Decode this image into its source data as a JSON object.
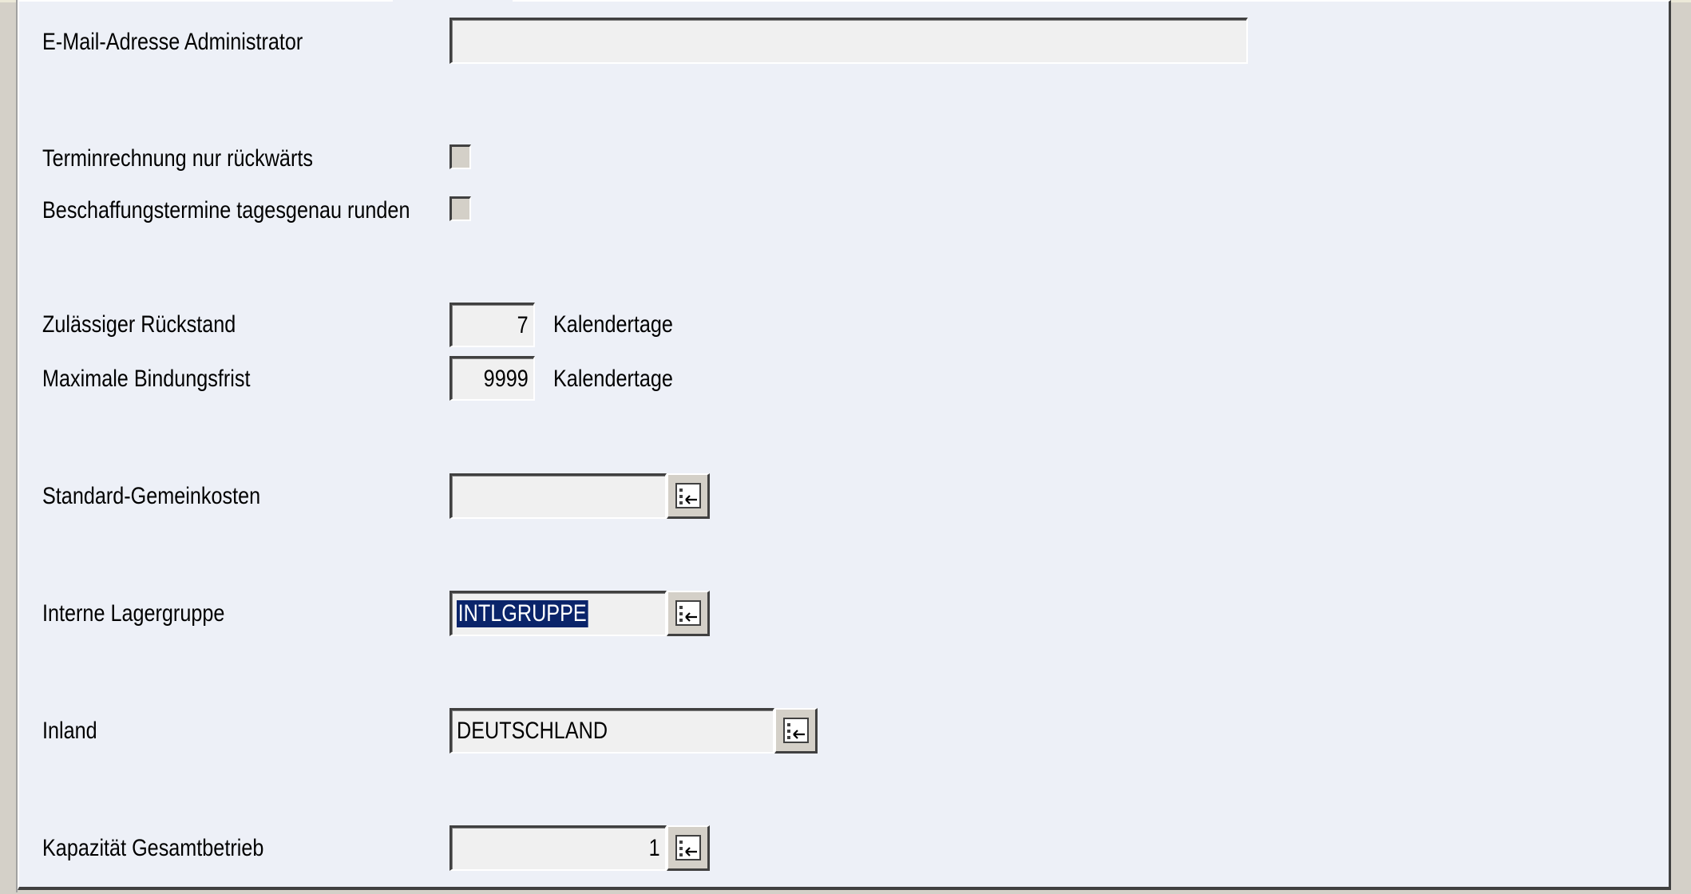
{
  "form": {
    "email_admin": {
      "label": "E-Mail-Adresse Administrator",
      "value": ""
    },
    "backward_scheduling": {
      "label": "Terminrechnung nur rückwärts",
      "checked": false
    },
    "round_procurement": {
      "label": "Beschaffungstermine tagesgenau runden",
      "checked": false
    },
    "allowed_backlog": {
      "label": "Zulässiger Rückstand",
      "value": "7",
      "unit": "Kalendertage"
    },
    "max_binding_period": {
      "label": "Maximale Bindungsfrist",
      "value": "9999",
      "unit": "Kalendertage"
    },
    "standard_overhead": {
      "label": "Standard-Gemeinkosten",
      "value": ""
    },
    "internal_stock_group": {
      "label": "Interne Lagergruppe",
      "value": "INTLGRUPPE"
    },
    "domestic": {
      "label": "Inland",
      "value": "DEUTSCHLAND"
    },
    "total_capacity": {
      "label": "Kapazität Gesamtbetrieb",
      "value": "1"
    }
  },
  "icons": {
    "lookup": "lookup-list-icon"
  },
  "colors": {
    "panel_bg": "#edf0f7",
    "selection_bg": "#0a246a",
    "selection_fg": "#ffffff"
  }
}
